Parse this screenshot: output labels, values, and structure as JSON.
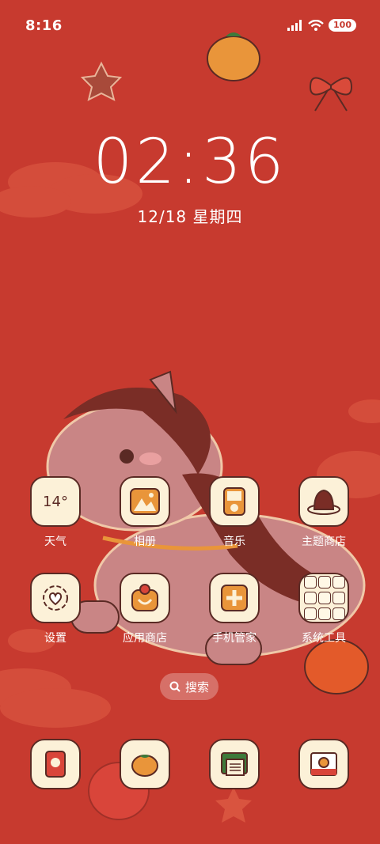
{
  "status_bar": {
    "time": "8:16",
    "battery": "100"
  },
  "lock": {
    "time": "02:36",
    "date": "12/18 星期四"
  },
  "apps": {
    "weather": {
      "label": "天气",
      "temp": "14°"
    },
    "gallery": {
      "label": "相册"
    },
    "music": {
      "label": "音乐"
    },
    "themes": {
      "label": "主题商店"
    },
    "settings": {
      "label": "设置"
    },
    "app_store": {
      "label": "应用商店"
    },
    "security": {
      "label": "手机管家"
    },
    "system_tools": {
      "label": "系统工具"
    }
  },
  "search": {
    "label": "搜索"
  },
  "dock": [
    "phone-icon",
    "persimmon-icon",
    "messages-icon",
    "camera-icon"
  ],
  "colors": {
    "background": "#c73a2f",
    "icon_bg": "#fcf1d8",
    "outline": "#5a2a24",
    "accent": "#e9953a"
  }
}
